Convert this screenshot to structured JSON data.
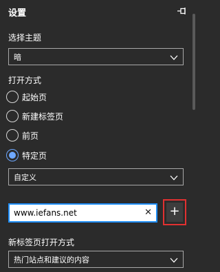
{
  "header": {
    "title": "设置"
  },
  "theme": {
    "label": "选择主题",
    "selected": "暗"
  },
  "open_with": {
    "label": "打开方式",
    "options": [
      {
        "label": "起始页",
        "checked": false
      },
      {
        "label": "新建标签页",
        "checked": false
      },
      {
        "label": "前页",
        "checked": false
      },
      {
        "label": "特定页",
        "checked": true
      }
    ],
    "custom_select": "自定义"
  },
  "url": {
    "value": "www.iefans.net",
    "clear_glyph": "✕",
    "add_glyph": "+"
  },
  "new_tab": {
    "label": "新标签页打开方式",
    "selected": "热门站点和建议的内容"
  },
  "colors": {
    "background": "#2b2b2b",
    "accent": "#6ea8ff",
    "focus": "#1f8fff",
    "highlight": "#e23131"
  },
  "icons": [
    "pin-icon",
    "chevron-down-icon",
    "clear-icon",
    "plus-icon"
  ]
}
